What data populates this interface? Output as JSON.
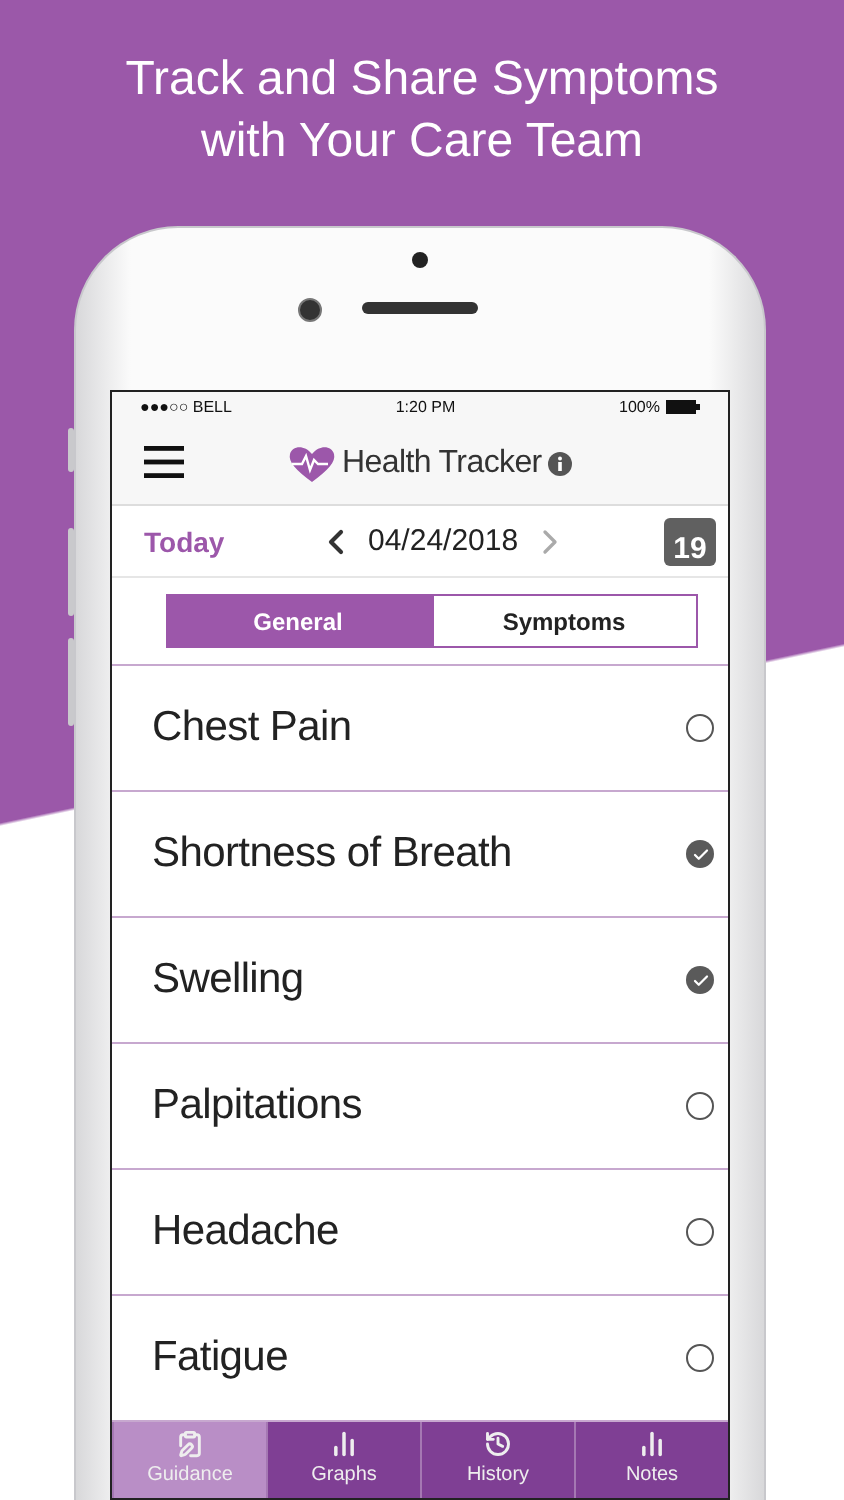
{
  "headline": [
    "Track and Share Symptoms",
    "with Your Care Team"
  ],
  "status_bar": {
    "carrier": "●●●○○ BELL",
    "time": "1:20 PM",
    "battery": "100%"
  },
  "app_title": "Health Tracker",
  "date_bar": {
    "today": "Today",
    "date": "04/24/2018",
    "calendar_day": "19"
  },
  "segments": [
    {
      "label": "General",
      "selected": true
    },
    {
      "label": "Symptoms",
      "selected": false
    }
  ],
  "symptoms": [
    {
      "label": "Chest Pain",
      "checked": false
    },
    {
      "label": "Shortness of Breath",
      "checked": true
    },
    {
      "label": "Swelling",
      "checked": true
    },
    {
      "label": "Palpitations",
      "checked": false
    },
    {
      "label": "Headache",
      "checked": false
    },
    {
      "label": "Fatigue",
      "checked": false
    }
  ],
  "tabs": [
    {
      "label": "Guidance",
      "kind": "guide",
      "selected": true
    },
    {
      "label": "Graphs",
      "kind": "chart",
      "selected": false
    },
    {
      "label": "History",
      "kind": "log",
      "selected": false
    },
    {
      "label": "Notes",
      "kind": "chart",
      "selected": false
    }
  ]
}
